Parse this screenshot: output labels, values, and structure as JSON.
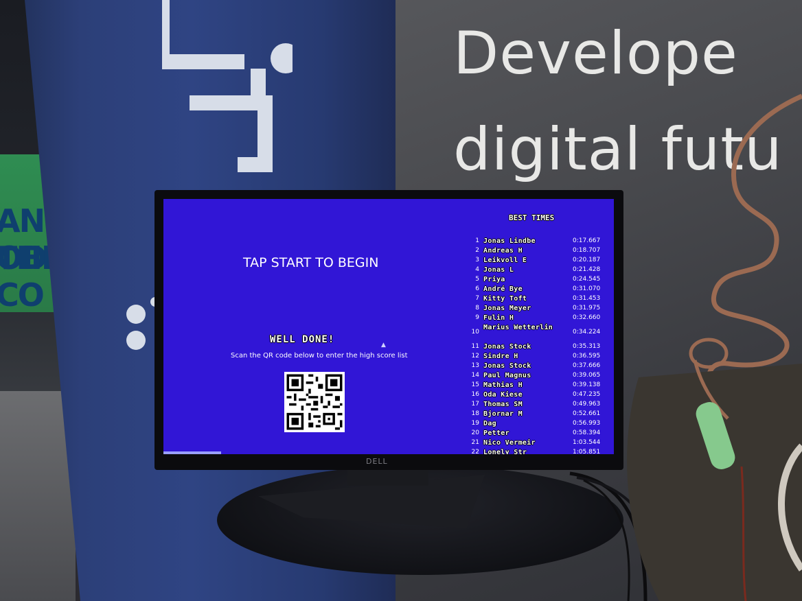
{
  "wall": {
    "line1": "Develope",
    "line2": "digital futu"
  },
  "booth": {
    "line1": "AN ODE",
    "line2": "THE CO"
  },
  "monitor": {
    "brand": "DELL"
  },
  "screen": {
    "tap_prompt": "TAP START TO BEGIN",
    "well_done": "WELL DONE!",
    "scan_text": "Scan the QR code below to enter the high score list",
    "best_times_title": "BEST TIMES",
    "scores": [
      {
        "rank": "1",
        "name": "Jonas Lindbe",
        "time": "0:17.667"
      },
      {
        "rank": "2",
        "name": "Andreas H",
        "time": "0:18.707"
      },
      {
        "rank": "3",
        "name": "Leikvoll E",
        "time": "0:20.187"
      },
      {
        "rank": "4",
        "name": "Jonas L",
        "time": "0:21.428"
      },
      {
        "rank": "5",
        "name": "Priya",
        "time": "0:24.545"
      },
      {
        "rank": "6",
        "name": "André Bye",
        "time": "0:31.070"
      },
      {
        "rank": "7",
        "name": "Kitty Toft",
        "time": "0:31.453"
      },
      {
        "rank": "8",
        "name": "Jonas Meyer",
        "time": "0:31.975"
      },
      {
        "rank": "9",
        "name": "Fulin H",
        "time": "0:32.660"
      },
      {
        "rank": "10",
        "name": "Marius Wetterlin",
        "time": "0:34.224"
      },
      {
        "rank": "11",
        "name": "Jonas Stock",
        "time": "0:35.313"
      },
      {
        "rank": "12",
        "name": "Sindre H",
        "time": "0:36.595"
      },
      {
        "rank": "13",
        "name": "Jonas Stock",
        "time": "0:37.666"
      },
      {
        "rank": "14",
        "name": "Paul Magnus",
        "time": "0:39.065"
      },
      {
        "rank": "15",
        "name": "Mathias H",
        "time": "0:39.138"
      },
      {
        "rank": "16",
        "name": "Oda Kiese",
        "time": "0:47.235"
      },
      {
        "rank": "17",
        "name": "Thomas SM",
        "time": "0:49.963"
      },
      {
        "rank": "18",
        "name": "Bjornar M",
        "time": "0:52.661"
      },
      {
        "rank": "19",
        "name": "Dag",
        "time": "0:56.993"
      },
      {
        "rank": "20",
        "name": "Petter",
        "time": "0:58.394"
      },
      {
        "rank": "21",
        "name": "Nico Vermeir",
        "time": "1:03.544"
      },
      {
        "rank": "22",
        "name": "Lonely Str",
        "time": "1:05.851"
      }
    ]
  },
  "colors": {
    "screen_bg": "#3116d6",
    "banner_blue": "#2f4483",
    "booth_green": "#2f8d52"
  },
  "icons": [
    "qr-code-icon",
    "cursor-icon",
    "banner-logo-icon"
  ]
}
